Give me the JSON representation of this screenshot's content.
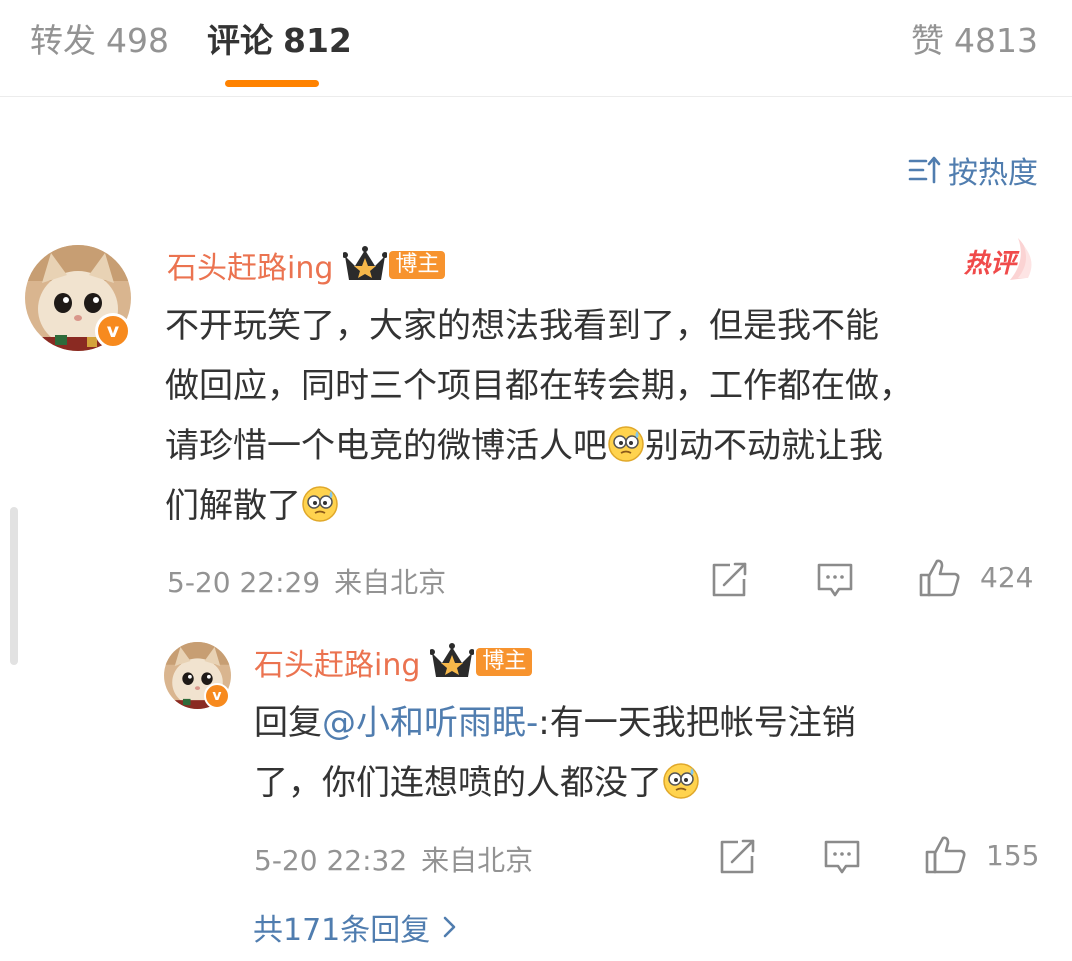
{
  "tabs": [
    {
      "label": "转发",
      "count": "498"
    },
    {
      "label": "评论",
      "count": "812"
    },
    {
      "label": "赞",
      "count": "4813"
    }
  ],
  "sort": {
    "label": "按热度",
    "icon": "sort-icon"
  },
  "colors": {
    "accent": "#ff8200",
    "username": "#eb7350",
    "link": "#507daf",
    "meta": "#939393",
    "text": "#333333",
    "badge": "#f7932e",
    "hot": "#f04a4a"
  },
  "comment": {
    "username": "石头赶路ing",
    "owner_badge": "博主",
    "hot_tag": "热评",
    "text": {
      "line1": "不开玩笑了，大家的想法我看到了，但是我不能",
      "line2": "做回应，同时三个项目都在转会期，工作都在做，",
      "line3_a": "请珍惜一个电竞的微博活人吧",
      "line3_b": "别动不动就让我",
      "line4": "们解散了"
    },
    "time": "5-20 22:29",
    "location": "来自北京",
    "likes": "424"
  },
  "reply": {
    "username": "石头赶路ing",
    "owner_badge": "博主",
    "prefix": "回复",
    "mention": "@小和听雨眠-",
    "text": {
      "line1_rest": ":有一天我把帐号注销",
      "line2": "了，你们连想喷的人都没了"
    },
    "time": "5-20 22:32",
    "location": "来自北京",
    "likes": "155"
  },
  "more_replies": {
    "label": "共171条回复"
  }
}
